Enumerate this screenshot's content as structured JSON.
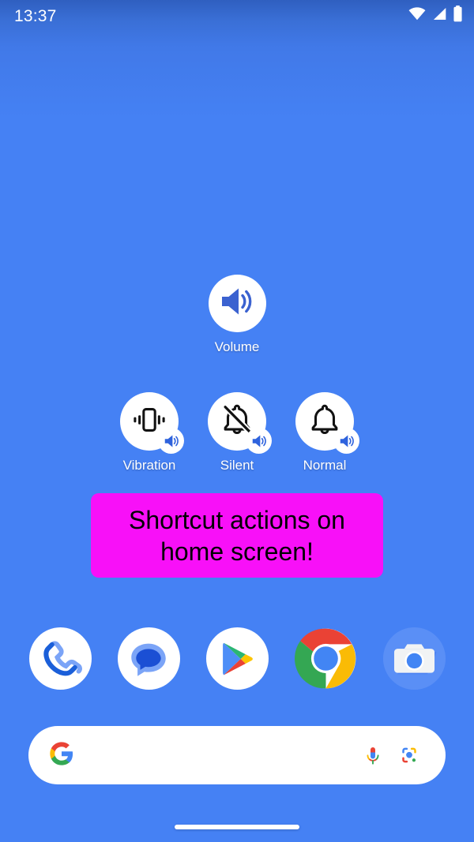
{
  "wallpaper": {
    "base_color": "#4581f4",
    "top_gradient_color": "#2f5fc0"
  },
  "status_bar": {
    "clock": "13:37",
    "icons": [
      {
        "name": "wifi-icon",
        "label": "Wi-Fi"
      },
      {
        "name": "cellular-signal-icon",
        "label": "Mobile signal"
      },
      {
        "name": "battery-icon",
        "label": "Battery full"
      }
    ]
  },
  "volume_widget": {
    "label": "Volume",
    "icon": "volume-up-icon",
    "icon_color": "#3b62d0",
    "circle_color": "#ffffff"
  },
  "shortcuts": [
    {
      "label": "Vibration",
      "icon": "vibration-icon",
      "badge_icon": "volume-up-badge-icon",
      "icon_color": "#121212",
      "badge_color": "#2f63dd"
    },
    {
      "label": "Silent",
      "icon": "bell-off-icon",
      "badge_icon": "volume-up-badge-icon",
      "icon_color": "#121212",
      "badge_color": "#2f63dd"
    },
    {
      "label": "Normal",
      "icon": "bell-icon",
      "badge_icon": "volume-up-badge-icon",
      "icon_color": "#121212",
      "badge_color": "#2f63dd"
    }
  ],
  "banner": {
    "text": "Shortcut actions on home screen!",
    "background_color": "#f810f8",
    "text_color": "#000000"
  },
  "dock": [
    {
      "name": "phone-app-icon",
      "label": "Phone"
    },
    {
      "name": "messages-app-icon",
      "label": "Messages"
    },
    {
      "name": "play-store-app-icon",
      "label": "Play Store"
    },
    {
      "name": "chrome-app-icon",
      "label": "Chrome"
    },
    {
      "name": "camera-app-icon",
      "label": "Camera"
    }
  ],
  "search": {
    "placeholder": "",
    "value": "",
    "logo_icon": "google-g-icon",
    "voice_icon": "microphone-icon",
    "lens_icon": "google-lens-icon"
  },
  "navigation": {
    "gesture_handle": "home-gesture-bar"
  }
}
